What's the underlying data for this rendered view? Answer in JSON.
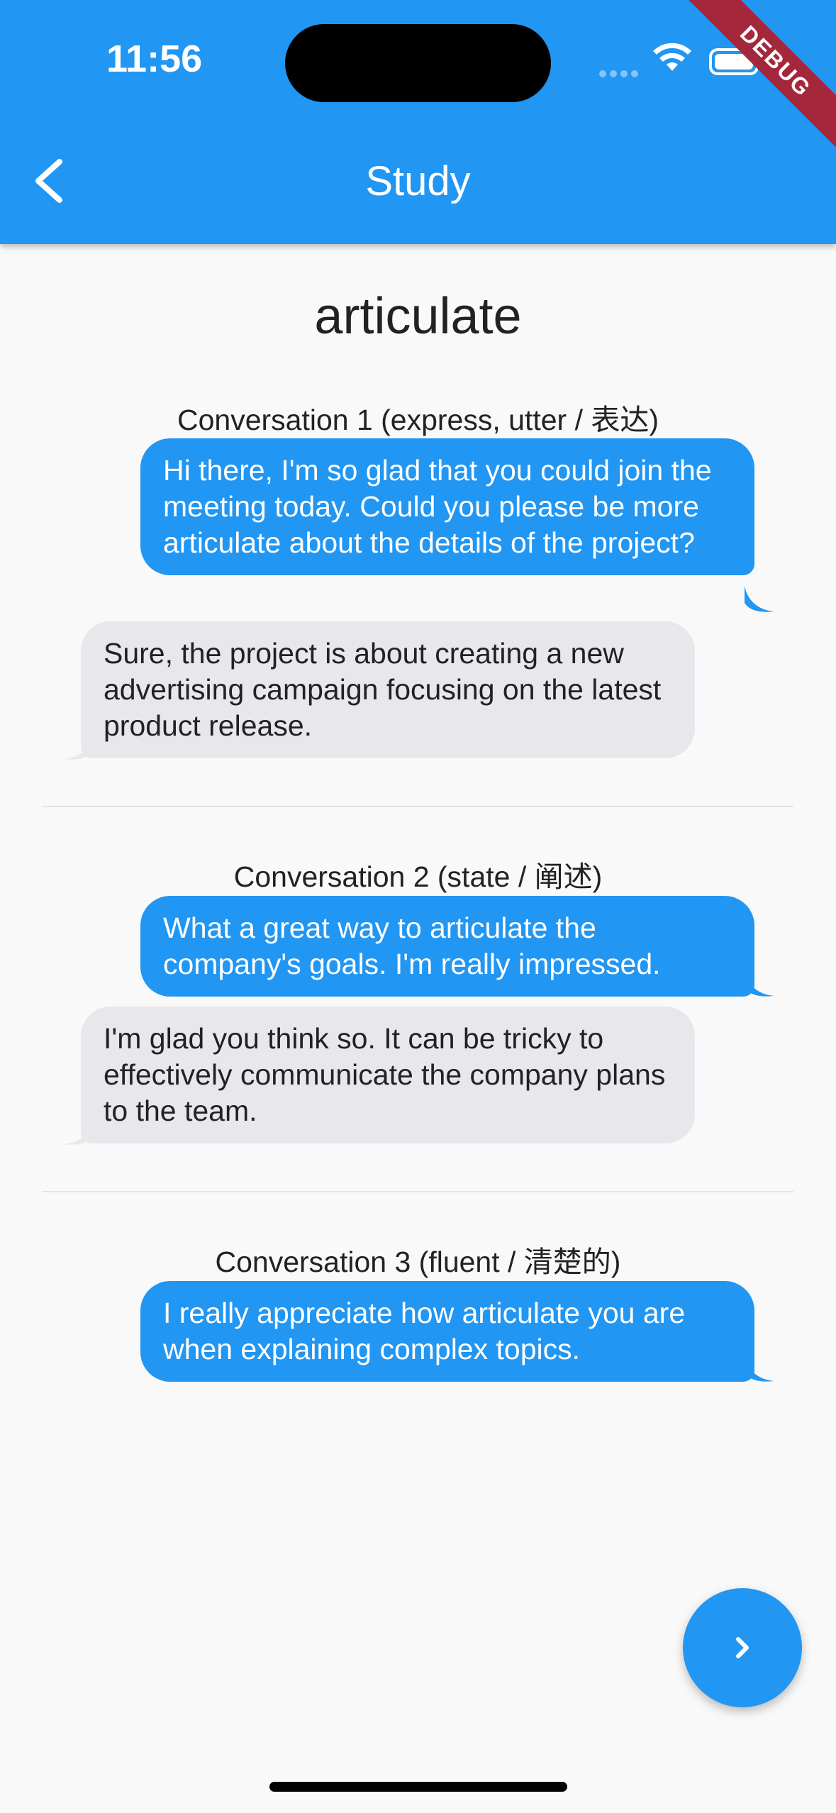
{
  "status_bar": {
    "time": "11:56"
  },
  "debug_banner": "DEBUG",
  "app_bar": {
    "title": "Study"
  },
  "word": "articulate",
  "conversations": [
    {
      "heading": "Conversation 1 (express, utter / 表达)",
      "messages": [
        {
          "from": "me",
          "text": "Hi there, I'm so glad that you could join the meeting today. Could you please be more articulate about the details of the project?"
        },
        {
          "from": "other",
          "text": "Sure, the project is about creating a new advertising campaign focusing on the latest product release."
        }
      ]
    },
    {
      "heading": "Conversation 2 (state / 阐述)",
      "messages": [
        {
          "from": "me",
          "text": "What a great way to articulate the company's goals. I'm really impressed."
        },
        {
          "from": "other",
          "text": "I'm glad you think so. It can be tricky to effectively communicate the company plans to the team."
        }
      ]
    },
    {
      "heading": "Conversation 3 (fluent / 清楚的)",
      "messages": [
        {
          "from": "me",
          "text": "I really appreciate how articulate you are when explaining complex topics."
        }
      ]
    }
  ],
  "colors": {
    "primary": "#2196f3",
    "incoming_bubble": "#e7e7ec",
    "background": "#f9f9f9",
    "debug_banner": "#a4273c"
  },
  "icons": {
    "back": "chevron-left-icon",
    "next": "chevron-right-icon",
    "wifi": "wifi-icon",
    "battery": "battery-icon",
    "signal": "cellular-signal-icon"
  }
}
